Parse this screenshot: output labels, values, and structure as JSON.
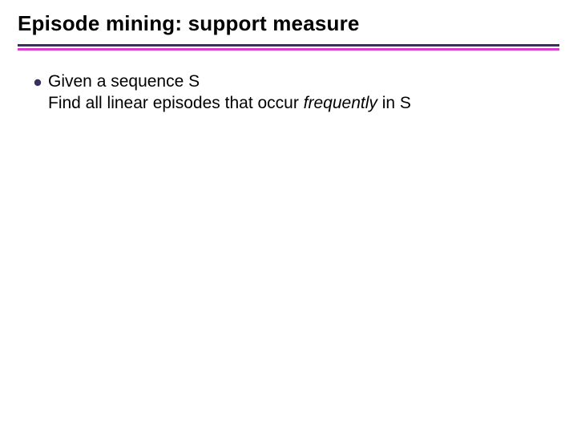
{
  "title": "Episode mining: support measure",
  "colors": {
    "rule_dark": "#3a2f5f",
    "rule_accent": "#d63fcf",
    "bullet_fill": "#3a2f5f"
  },
  "bullet": {
    "line1": "Given a sequence S",
    "line2_pre": "Find all linear episodes that occur ",
    "line2_ital": "frequently",
    "line2_post": " in S"
  }
}
